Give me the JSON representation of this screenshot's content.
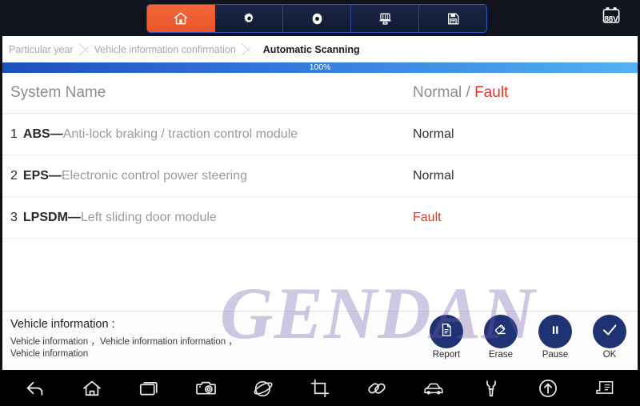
{
  "topbar": {
    "tools": [
      {
        "name": "home-icon",
        "label": "Home",
        "active": true
      },
      {
        "name": "gear-icon",
        "label": "Settings",
        "active": false
      },
      {
        "name": "record-icon",
        "label": "Record",
        "active": false
      },
      {
        "name": "print-icon",
        "label": "Print",
        "active": false
      },
      {
        "name": "save-icon",
        "label": "Save",
        "active": false
      }
    ],
    "battery": {
      "name": "battery-icon",
      "value": "88V"
    }
  },
  "breadcrumb": {
    "items": [
      {
        "label": "Particular year",
        "current": false
      },
      {
        "label": "Vehicle information confirmation",
        "current": false
      },
      {
        "label": "Automatic Scanning",
        "current": true
      }
    ]
  },
  "progress": {
    "percent": 100,
    "label": "100%"
  },
  "table": {
    "headers": {
      "system_name": "System Name",
      "status_normal": "Normal",
      "status_separator": " / ",
      "status_fault": "Fault"
    },
    "rows": [
      {
        "index": "1",
        "abbr": "ABS",
        "dash": "—",
        "description": "Anti-lock braking / traction control module",
        "status": "Normal",
        "fault": false
      },
      {
        "index": "2",
        "abbr": "EPS",
        "dash": "—",
        "description": "Electronic control power steering",
        "status": "Normal",
        "fault": false
      },
      {
        "index": "3",
        "abbr": "LPSDM",
        "dash": "—",
        "description": "Left sliding door module",
        "status": "Fault",
        "fault": true
      }
    ]
  },
  "footer": {
    "vehicle_info_title": "Vehicle information :",
    "vehicle_info_body": "Vehicle information ，Vehicle information information ，Vehicle information",
    "actions": [
      {
        "name": "report-button",
        "label": "Report",
        "icon": "document-icon"
      },
      {
        "name": "erase-button",
        "label": "Erase",
        "icon": "eraser-icon"
      },
      {
        "name": "pause-button",
        "label": "Pause",
        "icon": "pause-icon"
      },
      {
        "name": "ok-button",
        "label": "OK",
        "icon": "check-icon"
      }
    ]
  },
  "watermark": {
    "text": "GENDAN"
  },
  "navbar": {
    "items": [
      {
        "name": "back-icon",
        "label": "Back"
      },
      {
        "name": "home-icon",
        "label": "Home"
      },
      {
        "name": "recents-icon",
        "label": "Recent apps"
      },
      {
        "name": "camera-icon",
        "label": "Screenshot"
      },
      {
        "name": "browser-icon",
        "label": "Browser"
      },
      {
        "name": "crop-icon",
        "label": "Crop"
      },
      {
        "name": "link-icon",
        "label": "Link"
      },
      {
        "name": "car-icon",
        "label": "Vehicle"
      },
      {
        "name": "wrench-icon",
        "label": "Tools"
      },
      {
        "name": "upload-icon",
        "label": "Upload"
      },
      {
        "name": "document-list-icon",
        "label": "Documents"
      }
    ]
  },
  "colors": {
    "accent_orange": "#ea552a",
    "fault_red": "#ee3124",
    "action_blue": "#1f3273",
    "topbar_dark": "#11141e"
  }
}
